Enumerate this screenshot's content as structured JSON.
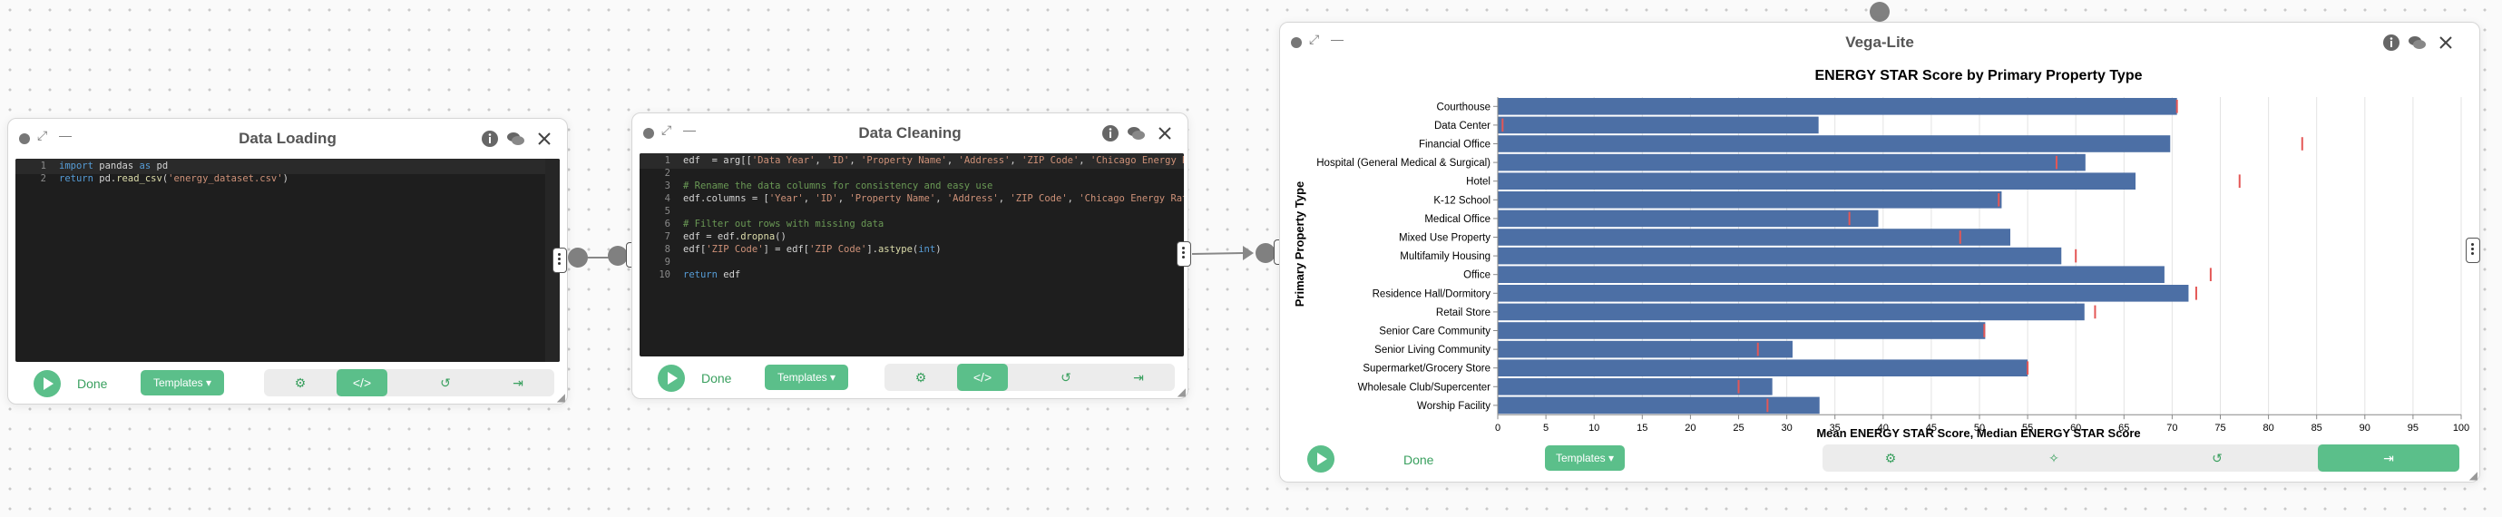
{
  "nodes": {
    "loading": {
      "title": "Data Loading",
      "lines": [
        "1",
        "2"
      ],
      "footer": {
        "done": "Done",
        "templates": "Templates ▾"
      }
    },
    "cleaning": {
      "title": "Data Cleaning",
      "lines": [
        "1",
        "2",
        "3",
        "4",
        "5",
        "6",
        "7",
        "8",
        "9",
        "10"
      ],
      "footer": {
        "done": "Done",
        "templates": "Templates ▾"
      }
    },
    "vega": {
      "title": "Vega-Lite",
      "footer": {
        "done": "Done",
        "templates": "Templates ▾"
      }
    }
  },
  "icons": {
    "info": "info-icon",
    "comments": "comments-icon",
    "close": "close-icon",
    "expand": "expand-icon",
    "minimize": "minimize-icon",
    "robot": "robot-icon",
    "code": "code-icon",
    "undo": "undo-icon",
    "export": "export-icon",
    "magic": "magic-icon"
  },
  "colors": {
    "accent": "#5bbf8a",
    "bar": "#4c6fa5",
    "median": "#e45756",
    "editor_bg": "#1e1e1e"
  },
  "chart_data": {
    "type": "bar",
    "title": "ENERGY STAR Score by Primary Property Type",
    "xlabel": "Mean ENERGY STAR Score, Median ENERGY STAR Score",
    "ylabel": "Primary Property Type",
    "xlim": [
      0,
      100
    ],
    "xticks": [
      0,
      5,
      10,
      15,
      20,
      25,
      30,
      35,
      40,
      45,
      50,
      55,
      60,
      65,
      70,
      75,
      80,
      85,
      90,
      95,
      100
    ],
    "grid": true,
    "categories": [
      "Courthouse",
      "Data Center",
      "Financial Office",
      "Hospital (General Medical & Surgical)",
      "Hotel",
      "K-12 School",
      "Medical Office",
      "Mixed Use Property",
      "Multifamily Housing",
      "Office",
      "Residence Hall/Dormitory",
      "Retail Store",
      "Senior Care Community",
      "Senior Living Community",
      "Supermarket/Grocery Store",
      "Wholesale Club/Supercenter",
      "Worship Facility"
    ],
    "series": [
      {
        "name": "Mean ENERGY STAR Score",
        "values": [
          70.5,
          33.3,
          69.8,
          61,
          66.2,
          52.3,
          39.5,
          53.2,
          58.5,
          69.2,
          71.7,
          60.9,
          50.6,
          30.6,
          55,
          28.5,
          33.4
        ]
      },
      {
        "name": "Median ENERGY STAR Score",
        "values": [
          70.5,
          0.5,
          83.5,
          58,
          77,
          52,
          36.5,
          48,
          60,
          74,
          72.5,
          62,
          50.5,
          27,
          55,
          25,
          28
        ]
      }
    ]
  }
}
